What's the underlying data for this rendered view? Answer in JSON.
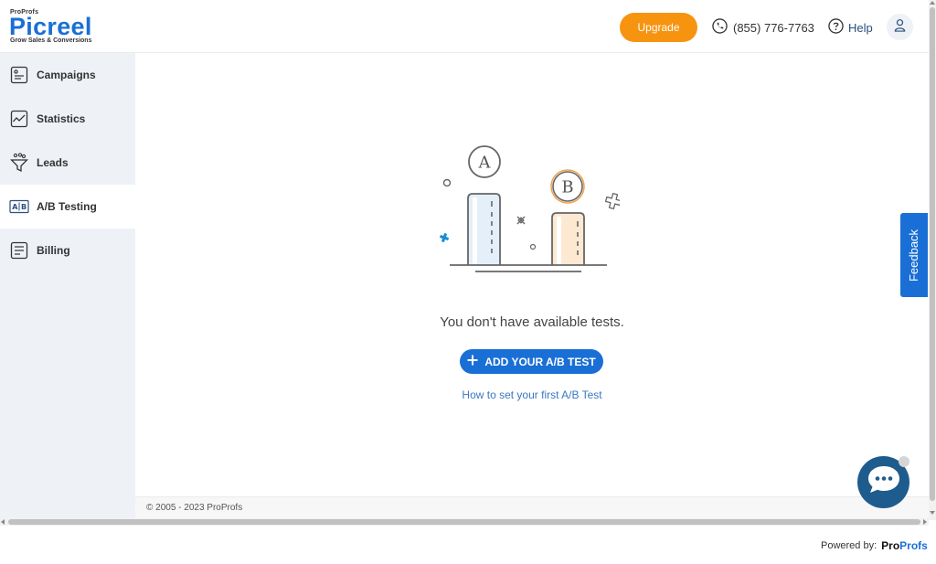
{
  "header": {
    "logo": {
      "company": "ProProfs",
      "name": "Picreel",
      "tagline": "Grow Sales & Conversions"
    },
    "upgrade_label": "Upgrade",
    "phone": "(855) 776-7763",
    "help_label": "Help"
  },
  "sidebar": {
    "items": [
      {
        "label": "Campaigns",
        "icon": "campaigns-icon"
      },
      {
        "label": "Statistics",
        "icon": "statistics-icon"
      },
      {
        "label": "Leads",
        "icon": "funnel-icon"
      },
      {
        "label": "A/B Testing",
        "icon": "ab-testing-icon",
        "active": true
      },
      {
        "label": "Billing",
        "icon": "billing-icon"
      }
    ]
  },
  "main": {
    "illustration": {
      "label_a": "A",
      "label_b": "B"
    },
    "empty_message": "You don't have available tests.",
    "add_button_label": "ADD YOUR A/B TEST",
    "howto_link": "How to set your first A/B Test"
  },
  "footer": {
    "copyright": "© 2005 - 2023 ProProfs"
  },
  "feedback_label": "Feedback",
  "powered_by": {
    "label": "Powered by:",
    "brand_pro": "Pro",
    "brand_profs": "Profs"
  },
  "colors": {
    "primary": "#1a6fd6",
    "accent": "#f7940f",
    "sidebar_bg": "#eef2f7",
    "chat": "#1f5c8e"
  }
}
